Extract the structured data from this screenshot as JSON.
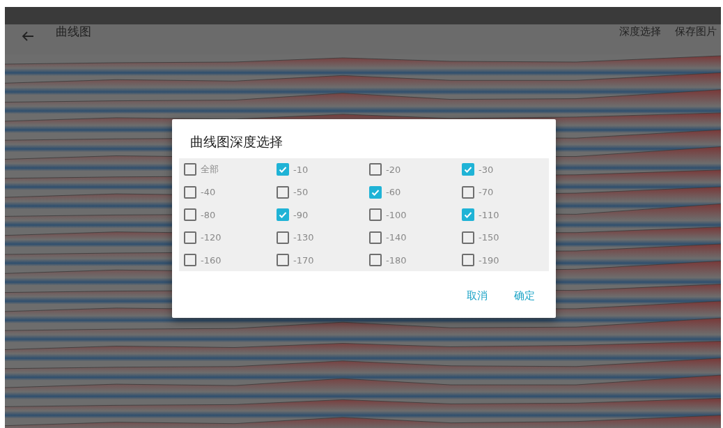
{
  "app_bar": {
    "title": "曲线图",
    "actions": [
      "深度选择",
      "保存图片"
    ]
  },
  "dialog": {
    "title": "曲线图深度选择",
    "options": [
      {
        "label": "全部",
        "checked": false
      },
      {
        "label": "-10",
        "checked": true
      },
      {
        "label": "-20",
        "checked": false
      },
      {
        "label": "-30",
        "checked": true
      },
      {
        "label": "-40",
        "checked": false
      },
      {
        "label": "-50",
        "checked": false
      },
      {
        "label": "-60",
        "checked": true
      },
      {
        "label": "-70",
        "checked": false
      },
      {
        "label": "-80",
        "checked": false
      },
      {
        "label": "-90",
        "checked": true
      },
      {
        "label": "-100",
        "checked": false
      },
      {
        "label": "-110",
        "checked": true
      },
      {
        "label": "-120",
        "checked": false
      },
      {
        "label": "-130",
        "checked": false
      },
      {
        "label": "-140",
        "checked": false
      },
      {
        "label": "-150",
        "checked": false
      },
      {
        "label": "-160",
        "checked": false
      },
      {
        "label": "-170",
        "checked": false
      },
      {
        "label": "-180",
        "checked": false
      },
      {
        "label": "-190",
        "checked": false
      }
    ],
    "buttons": [
      "取消",
      "确定"
    ]
  }
}
